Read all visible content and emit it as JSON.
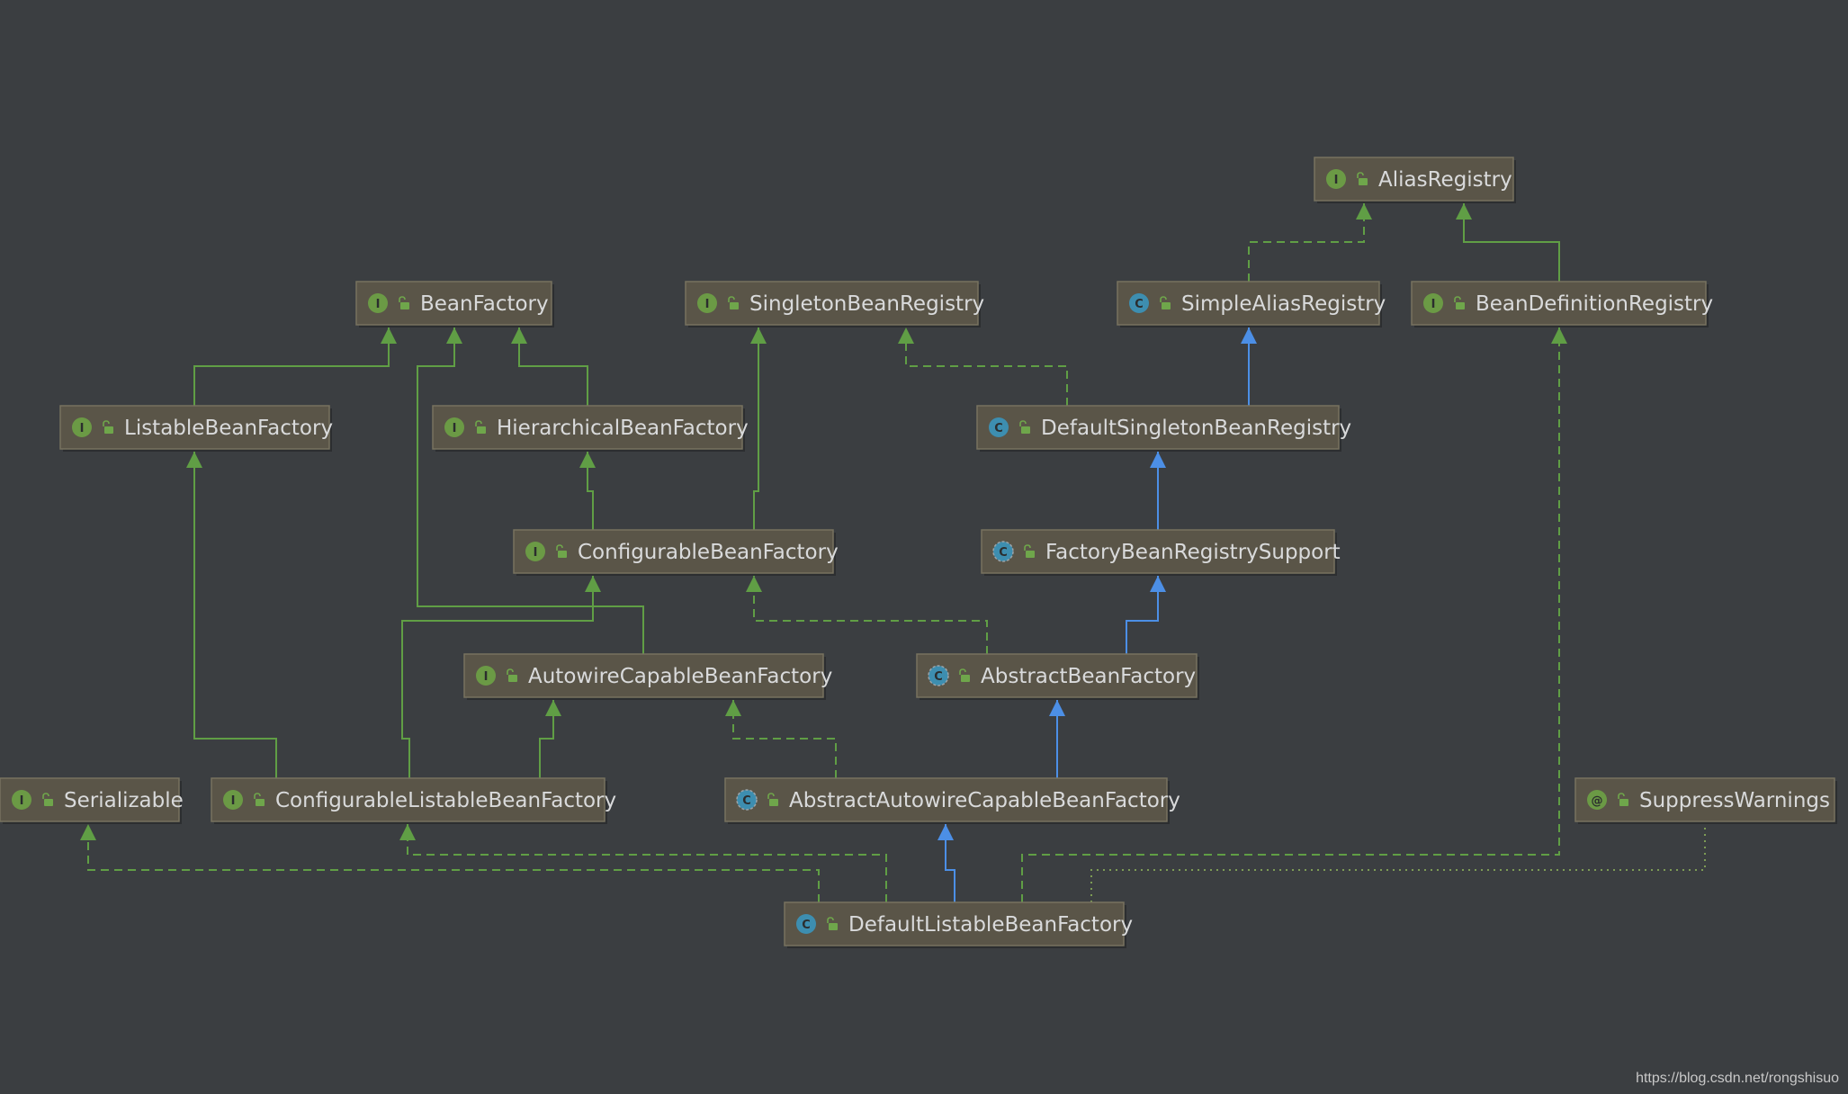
{
  "colors": {
    "background": "#3b3e41",
    "node_fill": "#5a5548",
    "node_border": "#77725f",
    "label": "#d9dadb",
    "interface_badge": "#6b9a45",
    "class_badge": "#3d8eb0",
    "annotation_badge": "#6b9a45",
    "lock_icon": "#6fa64b",
    "edge_interface": "#609e45",
    "edge_class": "#4c8fe6",
    "edge_dotted": "#7d9b55"
  },
  "nodes": [
    {
      "id": "AliasRegistry",
      "label": "AliasRegistry",
      "kind": "interface"
    },
    {
      "id": "BeanFactory",
      "label": "BeanFactory",
      "kind": "interface"
    },
    {
      "id": "SingletonBeanRegistry",
      "label": "SingletonBeanRegistry",
      "kind": "interface"
    },
    {
      "id": "SimpleAliasRegistry",
      "label": "SimpleAliasRegistry",
      "kind": "class"
    },
    {
      "id": "BeanDefinitionRegistry",
      "label": "BeanDefinitionRegistry",
      "kind": "interface"
    },
    {
      "id": "ListableBeanFactory",
      "label": "ListableBeanFactory",
      "kind": "interface"
    },
    {
      "id": "HierarchicalBeanFactory",
      "label": "HierarchicalBeanFactory",
      "kind": "interface"
    },
    {
      "id": "DefaultSingletonBeanRegistry",
      "label": "DefaultSingletonBeanRegistry",
      "kind": "class"
    },
    {
      "id": "ConfigurableBeanFactory",
      "label": "ConfigurableBeanFactory",
      "kind": "interface"
    },
    {
      "id": "FactoryBeanRegistrySupport",
      "label": "FactoryBeanRegistrySupport",
      "kind": "abstract"
    },
    {
      "id": "AutowireCapableBeanFactory",
      "label": "AutowireCapableBeanFactory",
      "kind": "interface"
    },
    {
      "id": "AbstractBeanFactory",
      "label": "AbstractBeanFactory",
      "kind": "abstract"
    },
    {
      "id": "Serializable",
      "label": "Serializable",
      "kind": "interface"
    },
    {
      "id": "ConfigurableListableBeanFactory",
      "label": "ConfigurableListableBeanFactory",
      "kind": "interface"
    },
    {
      "id": "AbstractAutowireCapableBeanFactory",
      "label": "AbstractAutowireCapableBeanFactory",
      "kind": "abstract"
    },
    {
      "id": "SuppressWarnings",
      "label": "SuppressWarnings",
      "kind": "annotation"
    },
    {
      "id": "DefaultListableBeanFactory",
      "label": "DefaultListableBeanFactory",
      "kind": "class"
    }
  ],
  "badge_letters": {
    "interface": "I",
    "class": "C",
    "abstract": "C",
    "annotation": "@"
  },
  "edges": [
    {
      "from": "SimpleAliasRegistry",
      "to": "AliasRegistry",
      "type": "implements"
    },
    {
      "from": "BeanDefinitionRegistry",
      "to": "AliasRegistry",
      "type": "extends-interface"
    },
    {
      "from": "ListableBeanFactory",
      "to": "BeanFactory",
      "type": "extends-interface"
    },
    {
      "from": "AutowireCapableBeanFactory",
      "to": "BeanFactory",
      "type": "extends-interface"
    },
    {
      "from": "HierarchicalBeanFactory",
      "to": "BeanFactory",
      "type": "extends-interface"
    },
    {
      "from": "DefaultSingletonBeanRegistry",
      "to": "SingletonBeanRegistry",
      "type": "implements"
    },
    {
      "from": "DefaultSingletonBeanRegistry",
      "to": "SimpleAliasRegistry",
      "type": "extends-class"
    },
    {
      "from": "ConfigurableBeanFactory",
      "to": "HierarchicalBeanFactory",
      "type": "extends-interface"
    },
    {
      "from": "ConfigurableBeanFactory",
      "to": "SingletonBeanRegistry",
      "type": "extends-interface"
    },
    {
      "from": "FactoryBeanRegistrySupport",
      "to": "DefaultSingletonBeanRegistry",
      "type": "extends-class"
    },
    {
      "from": "AbstractBeanFactory",
      "to": "FactoryBeanRegistrySupport",
      "type": "extends-class"
    },
    {
      "from": "AbstractBeanFactory",
      "to": "ConfigurableBeanFactory",
      "type": "implements"
    },
    {
      "from": "ConfigurableListableBeanFactory",
      "to": "ListableBeanFactory",
      "type": "extends-interface"
    },
    {
      "from": "ConfigurableListableBeanFactory",
      "to": "ConfigurableBeanFactory",
      "type": "extends-interface"
    },
    {
      "from": "ConfigurableListableBeanFactory",
      "to": "AutowireCapableBeanFactory",
      "type": "extends-interface"
    },
    {
      "from": "AbstractAutowireCapableBeanFactory",
      "to": "AbstractBeanFactory",
      "type": "extends-class"
    },
    {
      "from": "AbstractAutowireCapableBeanFactory",
      "to": "AutowireCapableBeanFactory",
      "type": "implements"
    },
    {
      "from": "DefaultListableBeanFactory",
      "to": "AbstractAutowireCapableBeanFactory",
      "type": "extends-class"
    },
    {
      "from": "DefaultListableBeanFactory",
      "to": "Serializable",
      "type": "implements"
    },
    {
      "from": "DefaultListableBeanFactory",
      "to": "ConfigurableListableBeanFactory",
      "type": "implements"
    },
    {
      "from": "DefaultListableBeanFactory",
      "to": "BeanDefinitionRegistry",
      "type": "implements"
    },
    {
      "from": "DefaultListableBeanFactory",
      "to": "SuppressWarnings",
      "type": "annotated-by"
    }
  ],
  "watermark": "https://blog.csdn.net/rongshisuo"
}
